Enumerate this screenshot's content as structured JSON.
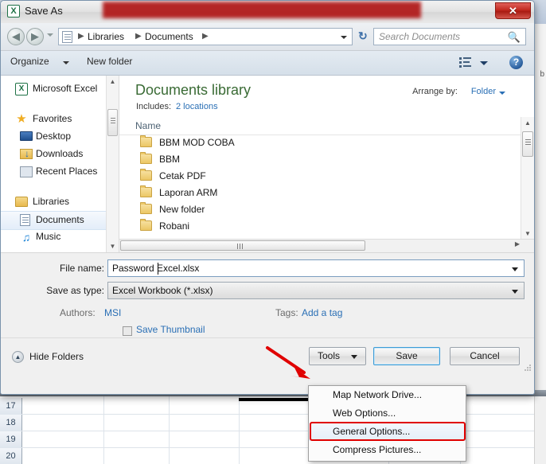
{
  "window": {
    "title": "Save As",
    "app_icon": "excel-icon",
    "icon_glyph": "X",
    "close_label": "✕",
    "redaction_color": "#b01616"
  },
  "navigation": {
    "back_glyph": "◀",
    "forward_glyph": "▶",
    "breadcrumb": [
      "Libraries",
      "Documents"
    ],
    "separator": "▶",
    "refresh_glyph": "↻",
    "search_placeholder": "Search Documents",
    "search_icon_glyph": "🔍"
  },
  "toolbar": {
    "organize_label": "Organize",
    "new_folder_label": "New folder",
    "view_icon": "list-view-icon",
    "help_glyph": "?"
  },
  "sidebar": {
    "items": [
      {
        "label": "Microsoft Excel",
        "icon": "excel-icon",
        "indent": false,
        "selected": false
      },
      {
        "label": "Favorites",
        "icon": "star-icon",
        "indent": false,
        "selected": false
      },
      {
        "label": "Desktop",
        "icon": "monitor-icon",
        "indent": true,
        "selected": false
      },
      {
        "label": "Downloads",
        "icon": "downloads-icon",
        "indent": true,
        "selected": false
      },
      {
        "label": "Recent Places",
        "icon": "recent-places-icon",
        "indent": true,
        "selected": false
      },
      {
        "label": "Libraries",
        "icon": "library-folder-icon",
        "indent": false,
        "selected": false
      },
      {
        "label": "Documents",
        "icon": "document-icon",
        "indent": true,
        "selected": true
      },
      {
        "label": "Music",
        "icon": "music-note-icon",
        "indent": true,
        "selected": false
      }
    ]
  },
  "content": {
    "library_title": "Documents library",
    "includes_label": "Includes:",
    "includes_link": "2 locations",
    "arrange_label": "Arrange by:",
    "arrange_value": "Folder",
    "column_header": "Name",
    "files": [
      {
        "name": "BBM MOD COBA",
        "icon": "folder-icon"
      },
      {
        "name": "BBM",
        "icon": "folder-icon"
      },
      {
        "name": "Cetak PDF",
        "icon": "folder-icon"
      },
      {
        "name": "Laporan ARM",
        "icon": "folder-icon"
      },
      {
        "name": "New folder",
        "icon": "folder-icon"
      },
      {
        "name": "Robani",
        "icon": "folder-icon"
      }
    ]
  },
  "form": {
    "filename_label": "File name:",
    "filename_value": "Password Excel.xlsx",
    "savetype_label": "Save as type:",
    "savetype_value": "Excel Workbook (*.xlsx)",
    "authors_label": "Authors:",
    "authors_value": "MSI",
    "tags_label": "Tags:",
    "tags_value": "Add a tag",
    "thumbnail_label": "Save Thumbnail",
    "thumbnail_checked": false
  },
  "footer": {
    "hide_folders_label": "Hide Folders",
    "hide_folders_glyph": "▲",
    "tools_label": "Tools",
    "save_label": "Save",
    "cancel_label": "Cancel"
  },
  "tools_menu": {
    "items": [
      {
        "label": "Map Network Drive...",
        "highlighted": false
      },
      {
        "label": "Web Options...",
        "highlighted": false
      },
      {
        "label": "General Options...",
        "highlighted": true
      },
      {
        "label": "Compress Pictures...",
        "highlighted": false
      }
    ],
    "highlight_color": "#e00000"
  },
  "annotation": {
    "arrow_color": "#e00000",
    "points_to": "tools-button"
  },
  "excel_background": {
    "row_numbers": [
      "17",
      "18",
      "19",
      "20"
    ]
  }
}
